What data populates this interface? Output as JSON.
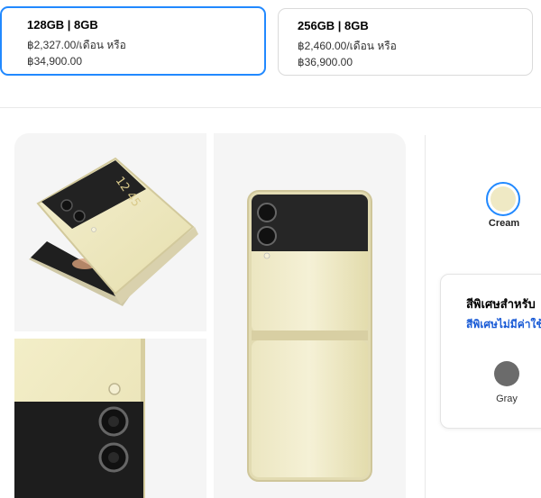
{
  "storage_options": [
    {
      "capacity": "128GB | 8GB",
      "monthly": "฿2,327.00/เดือน หรือ",
      "price": "฿34,900.00",
      "selected": true
    },
    {
      "capacity": "256GB | 8GB",
      "monthly": "฿2,460.00/เดือน หรือ",
      "price": "฿36,900.00",
      "selected": false
    }
  ],
  "phone_screen_time": "12 45",
  "colors": {
    "accent": "#2189ff",
    "cream": "#efe9c4",
    "gray": "#6b6b6b",
    "link": "#1a5bd6"
  },
  "color_option": {
    "label": "Cream",
    "swatch": "#efe9c4"
  },
  "special_panel": {
    "title": "สีพิเศษสำหรับ",
    "subtitle": "สีพิเศษไม่มีค่าใช้จ่าย",
    "option_label": "Gray",
    "option_swatch": "#6b6b6b"
  }
}
